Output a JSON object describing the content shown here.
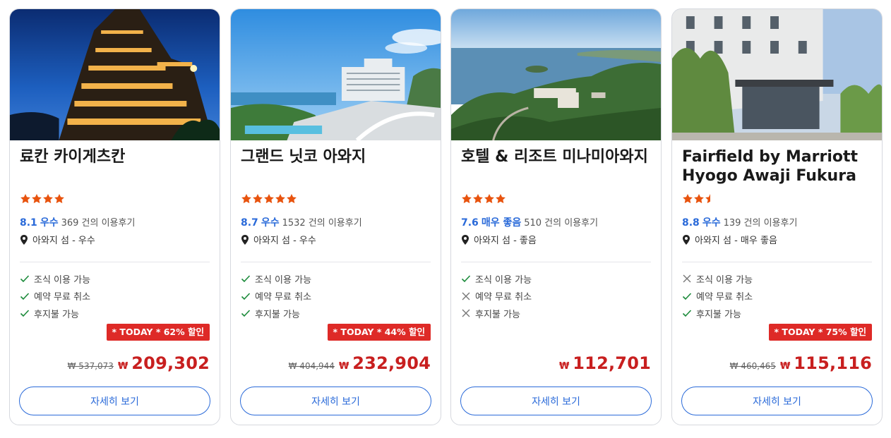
{
  "colors": {
    "accent": "#2a6ad9",
    "star": "#e8530e",
    "deal_bg": "#de2a27",
    "price": "#c81f1f",
    "check": "#1b8a3a",
    "cross": "#777777"
  },
  "hotels": [
    {
      "name": "료칸 카이게츠칸",
      "stars": 4,
      "score": "8.1",
      "score_label": "우수",
      "reviews": "369 건의 이용후기",
      "location": "아와지 섬 - 우수",
      "amenities": [
        {
          "label": "조식 이용 가능",
          "available": true
        },
        {
          "label": "예약 무료 취소",
          "available": true
        },
        {
          "label": "후지불 가능",
          "available": true
        }
      ],
      "deal": "* TODAY * 62% 할인",
      "old_price": "₩ 537,073",
      "currency": "₩",
      "price": "209,302",
      "button": "자세히 보기"
    },
    {
      "name": "그랜드 닛코 아와지",
      "stars": 5,
      "score": "8.7",
      "score_label": "우수",
      "reviews": "1532 건의 이용후기",
      "location": "아와지 섬 - 우수",
      "amenities": [
        {
          "label": "조식 이용 가능",
          "available": true
        },
        {
          "label": "예약 무료 취소",
          "available": true
        },
        {
          "label": "후지불 가능",
          "available": true
        }
      ],
      "deal": "* TODAY * 44% 할인",
      "old_price": "₩ 404,944",
      "currency": "₩",
      "price": "232,904",
      "button": "자세히 보기"
    },
    {
      "name": "호텔 & 리조트 미나미아와지",
      "stars": 4,
      "score": "7.6",
      "score_label": "매우 좋음",
      "reviews": "510 건의 이용후기",
      "location": "아와지 섬 - 좋음",
      "amenities": [
        {
          "label": "조식 이용 가능",
          "available": true
        },
        {
          "label": "예약 무료 취소",
          "available": false
        },
        {
          "label": "후지불 가능",
          "available": false
        }
      ],
      "deal": "",
      "old_price": "",
      "currency": "₩",
      "price": "112,701",
      "button": "자세히 보기"
    },
    {
      "name": "Fairfield by Marriott Hyogo Awaji Fukura",
      "stars": 2.5,
      "score": "8.8",
      "score_label": "우수",
      "reviews": "139 건의 이용후기",
      "location": "아와지 섬 - 매우 좋음",
      "amenities": [
        {
          "label": "조식 이용 가능",
          "available": false
        },
        {
          "label": "예약 무료 취소",
          "available": true
        },
        {
          "label": "후지불 가능",
          "available": true
        }
      ],
      "deal": "* TODAY * 75% 할인",
      "old_price": "₩ 460,465",
      "currency": "₩",
      "price": "115,116",
      "button": "자세히 보기"
    }
  ]
}
